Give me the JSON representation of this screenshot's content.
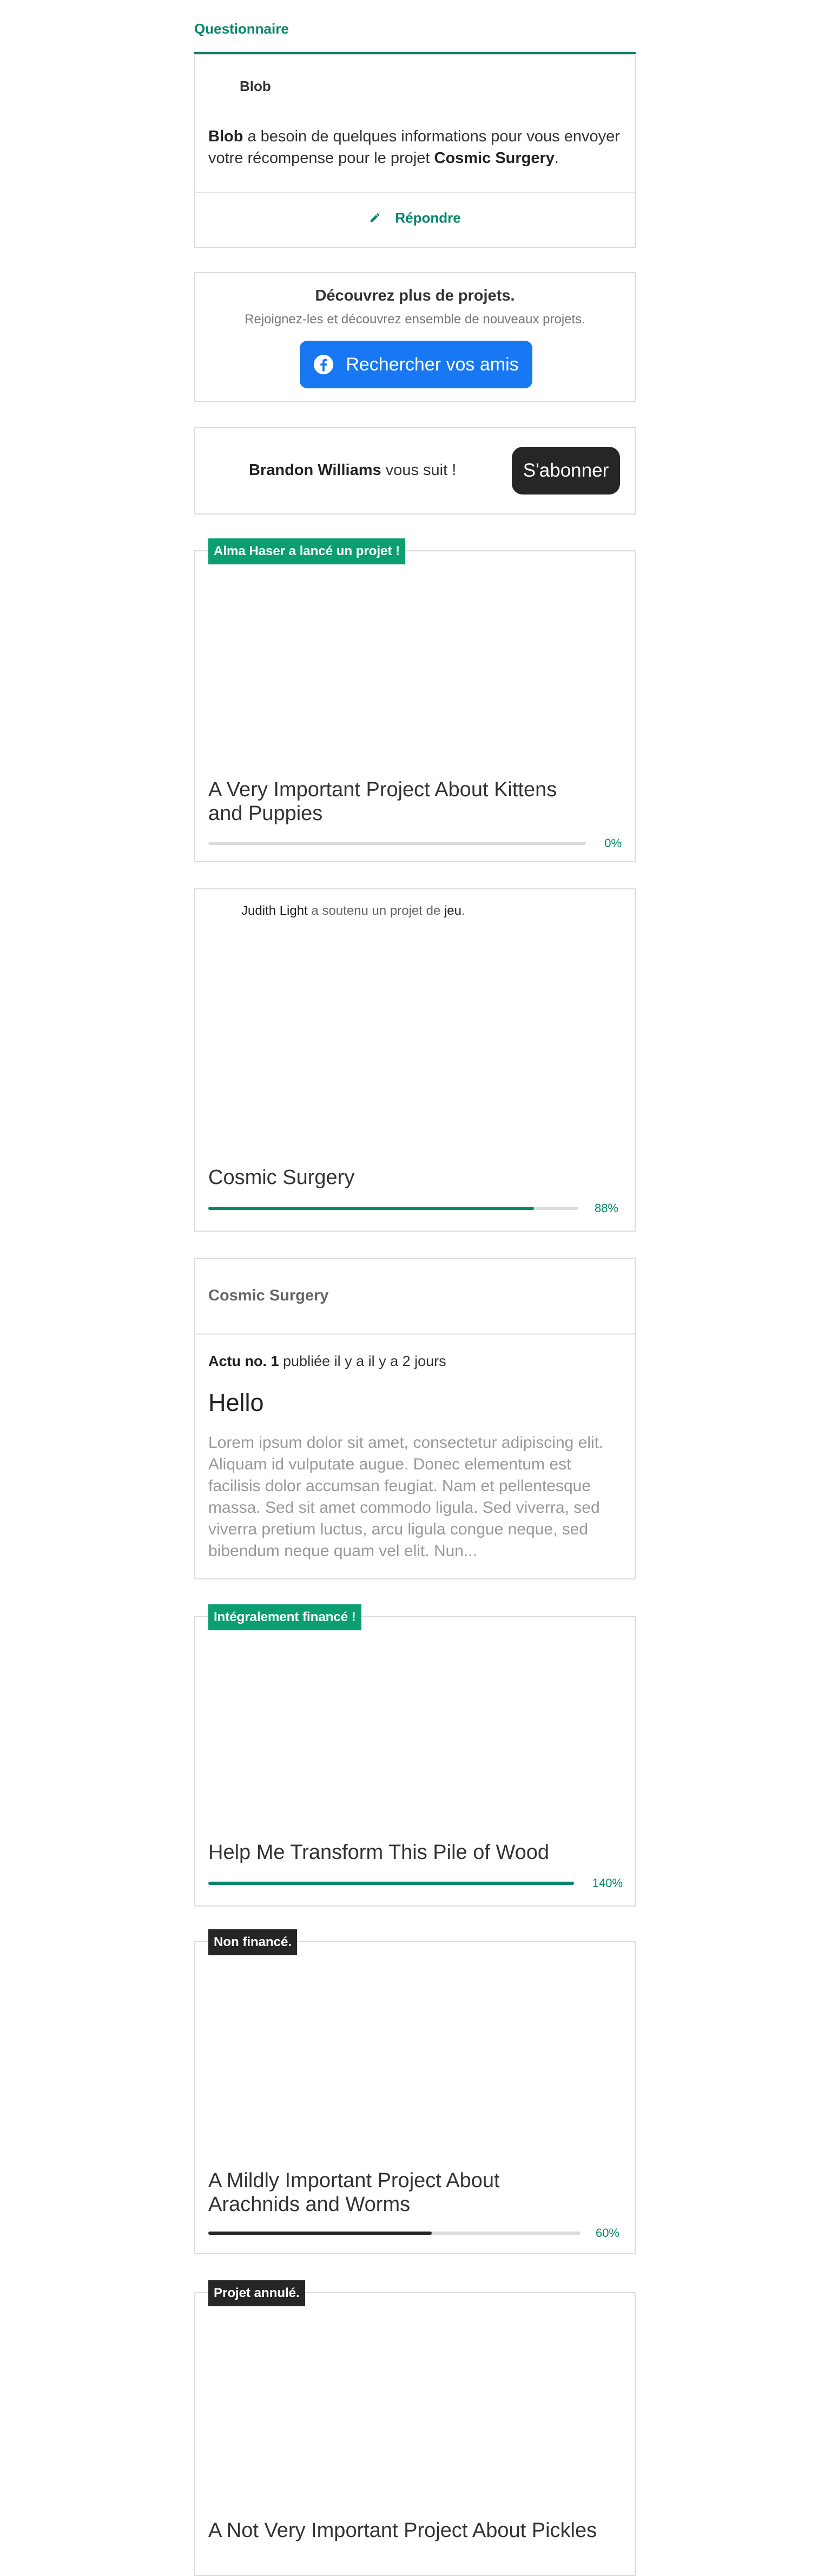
{
  "questionnaire": {
    "header": "Questionnaire",
    "sender": "Blob",
    "text_prefix_bold": "Blob",
    "text_middle": " a besoin de quelques informations pour vous envoyer votre récompense pour le projet ",
    "project_bold": "Cosmic Surgery",
    "text_suffix": ".",
    "reply_label": "Répondre",
    "reply_icon": "pencil-icon"
  },
  "discover": {
    "title": "Découvrez plus de projets.",
    "subtitle": "Rejoignez-les et découvrez ensemble de nouveaux projets.",
    "button_label": "Rechercher vos amis",
    "button_icon": "facebook-icon",
    "button_color": "#1877f2"
  },
  "follow": {
    "name": "Brandon Williams",
    "text": " vous suit !",
    "button_label": "S'abonner"
  },
  "projects": [
    {
      "badge": "Alma Haser a lancé un projet !",
      "title": "A Very Important Project About Kittens and Puppies",
      "percent_label": "0%",
      "progress": 0
    },
    {
      "backer_name": "Judith Light",
      "backer_text": " a soutenu un projet de ",
      "backer_target": "jeu",
      "backer_end": ".",
      "title": "Cosmic Surgery",
      "percent_label": "88%",
      "progress": 0.88
    },
    {
      "badge": "Intégralement financé !",
      "title": "Help Me Transform This Pile of Wood",
      "percent_label": "140%",
      "progress": 1.0
    },
    {
      "badge": "Non financé.",
      "title": "A Mildly Important Project About Arachnids and Worms",
      "percent_label": "60%",
      "progress": 0.6
    },
    {
      "badge": "Projet annulé.",
      "title": "A Not Very Important Project About Pickles"
    }
  ],
  "news": {
    "project": "Cosmic Surgery",
    "update_label": "Actu no. 1",
    "update_meta": " publiée il y a il y a 2 jours",
    "heading": "Hello",
    "body": "Lorem ipsum dolor sit amet, consectetur adipiscing elit. Aliquam id vulputate augue. Donec elementum est facilisis dolor accumsan feugiat. Nam et pellentesque massa. Sed sit amet commodo ligula. Sed viverra, sed viverra pretium luctus, arcu ligula congue neque, sed bibendum neque quam vel elit. Nun..."
  },
  "colors": {
    "accent": "#05876a",
    "badge_green": "#0b9e70",
    "dark": "#262626"
  }
}
